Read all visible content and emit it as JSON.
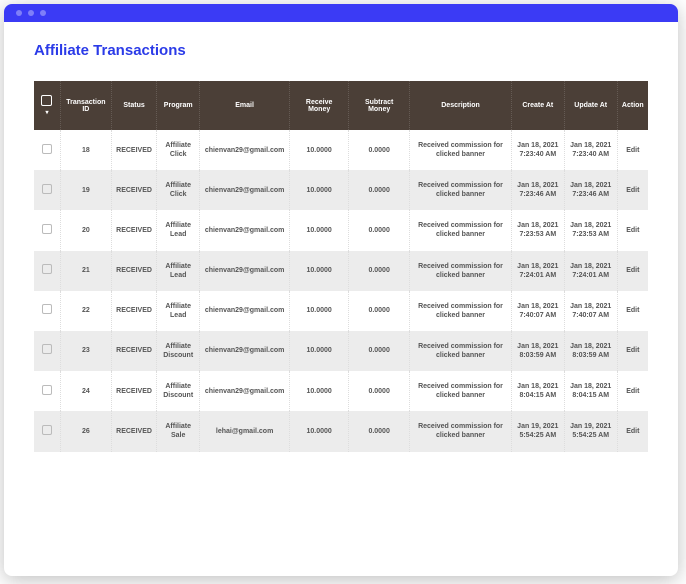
{
  "page": {
    "title": "Affiliate Transactions"
  },
  "table": {
    "headers": {
      "transaction_id": "Transaction ID",
      "status": "Status",
      "program": "Program",
      "email": "Email",
      "receive_money": "Receive Money",
      "subtract_money": "Subtract Money",
      "description": "Description",
      "create_at": "Create At",
      "update_at": "Update At",
      "action": "Action"
    },
    "rows": [
      {
        "id": "18",
        "status": "RECEIVED",
        "program": "Affiliate Click",
        "email": "chienvan29@gmail.com",
        "receive": "10.0000",
        "subtract": "0.0000",
        "description": "Received commission for clicked banner",
        "create_at": "Jan 18, 2021 7:23:40 AM",
        "update_at": "Jan 18, 2021 7:23:40 AM",
        "action": "Edit"
      },
      {
        "id": "19",
        "status": "RECEIVED",
        "program": "Affiliate Click",
        "email": "chienvan29@gmail.com",
        "receive": "10.0000",
        "subtract": "0.0000",
        "description": "Received commission for clicked banner",
        "create_at": "Jan 18, 2021 7:23:46 AM",
        "update_at": "Jan 18, 2021 7:23:46 AM",
        "action": "Edit"
      },
      {
        "id": "20",
        "status": "RECEIVED",
        "program": "Affiliate Lead",
        "email": "chienvan29@gmail.com",
        "receive": "10.0000",
        "subtract": "0.0000",
        "description": "Received commission for clicked banner",
        "create_at": "Jan 18, 2021 7:23:53 AM",
        "update_at": "Jan 18, 2021 7:23:53 AM",
        "action": "Edit"
      },
      {
        "id": "21",
        "status": "RECEIVED",
        "program": "Affiliate Lead",
        "email": "chienvan29@gmail.com",
        "receive": "10.0000",
        "subtract": "0.0000",
        "description": "Received commission for clicked banner",
        "create_at": "Jan 18, 2021 7:24:01 AM",
        "update_at": "Jan 18, 2021 7:24:01 AM",
        "action": "Edit"
      },
      {
        "id": "22",
        "status": "RECEIVED",
        "program": "Affiliate Lead",
        "email": "chienvan29@gmail.com",
        "receive": "10.0000",
        "subtract": "0.0000",
        "description": "Received commission for clicked banner",
        "create_at": "Jan 18, 2021 7:40:07 AM",
        "update_at": "Jan 18, 2021 7:40:07 AM",
        "action": "Edit"
      },
      {
        "id": "23",
        "status": "RECEIVED",
        "program": "Affiliate Discount",
        "email": "chienvan29@gmail.com",
        "receive": "10.0000",
        "subtract": "0.0000",
        "description": "Received commission for clicked banner",
        "create_at": "Jan 18, 2021 8:03:59 AM",
        "update_at": "Jan 18, 2021 8:03:59 AM",
        "action": "Edit"
      },
      {
        "id": "24",
        "status": "RECEIVED",
        "program": "Affiliate Discount",
        "email": "chienvan29@gmail.com",
        "receive": "10.0000",
        "subtract": "0.0000",
        "description": "Received commission for clicked banner",
        "create_at": "Jan 18, 2021 8:04:15 AM",
        "update_at": "Jan 18, 2021 8:04:15 AM",
        "action": "Edit"
      },
      {
        "id": "26",
        "status": "RECEIVED",
        "program": "Affiliate Sale",
        "email": "lehai@gmail.com",
        "receive": "10.0000",
        "subtract": "0.0000",
        "description": "Received commission for clicked banner",
        "create_at": "Jan 19, 2021 5:54:25 AM",
        "update_at": "Jan 19, 2021 5:54:25 AM",
        "action": "Edit"
      }
    ]
  }
}
